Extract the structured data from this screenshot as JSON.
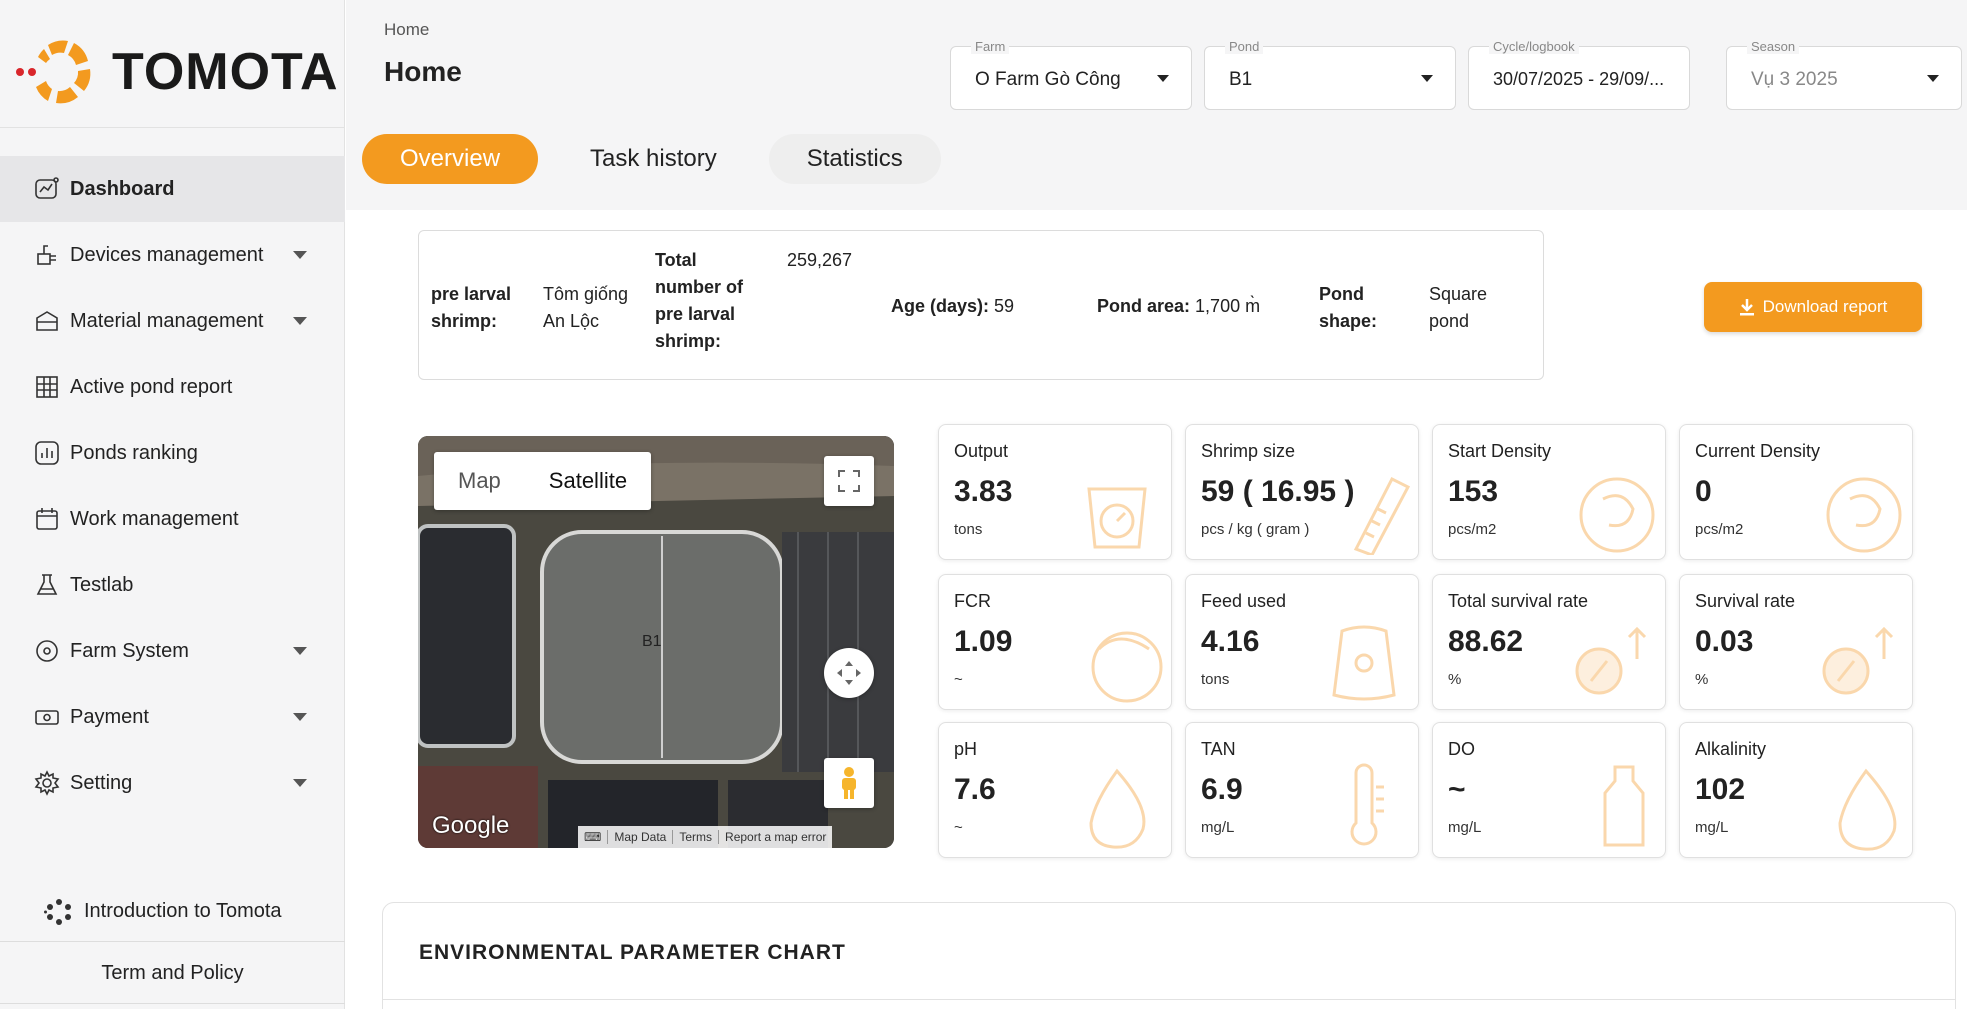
{
  "brand": {
    "name": "TOMOTA",
    "accent": "#f39a1f"
  },
  "sidebar": {
    "items": [
      {
        "label": "Dashboard",
        "icon": "chart-line-icon",
        "active": true
      },
      {
        "label": "Devices management",
        "icon": "device-icon",
        "caret": true
      },
      {
        "label": "Material management",
        "icon": "box-icon",
        "caret": true
      },
      {
        "label": "Active pond report",
        "icon": "grid-icon"
      },
      {
        "label": "Ponds ranking",
        "icon": "ranking-icon"
      },
      {
        "label": "Work management",
        "icon": "calendar-icon"
      },
      {
        "label": "Testlab",
        "icon": "flask-icon"
      },
      {
        "label": "Farm System",
        "icon": "location-icon",
        "caret": true
      },
      {
        "label": "Payment",
        "icon": "money-icon",
        "caret": true
      },
      {
        "label": "Setting",
        "icon": "gear-icon",
        "caret": true
      }
    ],
    "intro": "Introduction to Tomota",
    "term": "Term and Policy"
  },
  "header": {
    "breadcrumb": "Home",
    "title": "Home",
    "filters": {
      "farm": {
        "label": "Farm",
        "value": "O Farm Gò Công"
      },
      "pond": {
        "label": "Pond",
        "value": "B1"
      },
      "cycle": {
        "label": "Cycle/logbook",
        "value": "30/07/2025 - 29/09/..."
      },
      "season": {
        "label": "Season",
        "value": "Vụ 3 2025"
      }
    }
  },
  "tabs": [
    "Overview",
    "Task history",
    "Statistics"
  ],
  "info": {
    "pre_larval_label_1": "pre larval",
    "pre_larval_label_2": "shrimp:",
    "pre_larval_value_1": "Tôm giống",
    "pre_larval_value_2": "An Lộc",
    "total_label_1": "Total",
    "total_label_2": "number of",
    "total_label_3": "pre larval",
    "total_label_4": "shrimp:",
    "total_value": "259,267",
    "age_label": "Age (days):",
    "age_value": "59",
    "area_label": "Pond area:",
    "area_value": "1,700 m̀",
    "shape_label_1": "Pond",
    "shape_label_2": "shape:",
    "shape_value_1": "Square",
    "shape_value_2": "pond"
  },
  "download_label": "Download report",
  "map": {
    "map_label": "Map",
    "satellite_label": "Satellite",
    "pond_label": "B1",
    "google": "Google",
    "map_data": "Map Data",
    "terms": "Terms",
    "report": "Report a map error"
  },
  "stats": [
    {
      "title": "Output",
      "value": "3.83",
      "unit": "tons",
      "icon": "scale-icon"
    },
    {
      "title": "Shrimp size",
      "value": "59 ( 16.95 )",
      "unit": "pcs / kg ( gram )",
      "icon": "ruler-icon"
    },
    {
      "title": "Start Density",
      "value": "153",
      "unit": "pcs/m2",
      "icon": "shrimp-icon"
    },
    {
      "title": "Current Density",
      "value": "0",
      "unit": "pcs/m2",
      "icon": "shrimp-icon"
    },
    {
      "title": "FCR",
      "value": "1.09",
      "unit": "~",
      "icon": "fcr-icon"
    },
    {
      "title": "Feed used",
      "value": "4.16",
      "unit": "tons",
      "icon": "feed-bag-icon"
    },
    {
      "title": "Total survival rate",
      "value": "88.62",
      "unit": "%",
      "icon": "percent-icon"
    },
    {
      "title": "Survival rate",
      "value": "0.03",
      "unit": "%",
      "icon": "percent-icon"
    },
    {
      "title": "pH",
      "value": "7.6",
      "unit": "~",
      "icon": "ph-icon"
    },
    {
      "title": "TAN",
      "value": "6.9",
      "unit": "mg/L",
      "icon": "thermometer-icon"
    },
    {
      "title": "DO",
      "value": "~",
      "unit": "mg/L",
      "icon": "bottle-icon"
    },
    {
      "title": "Alkalinity",
      "value": "102",
      "unit": "mg/L",
      "icon": "calcium-icon"
    }
  ],
  "env_chart_title": "ENVIRONMENTAL PARAMETER CHART"
}
